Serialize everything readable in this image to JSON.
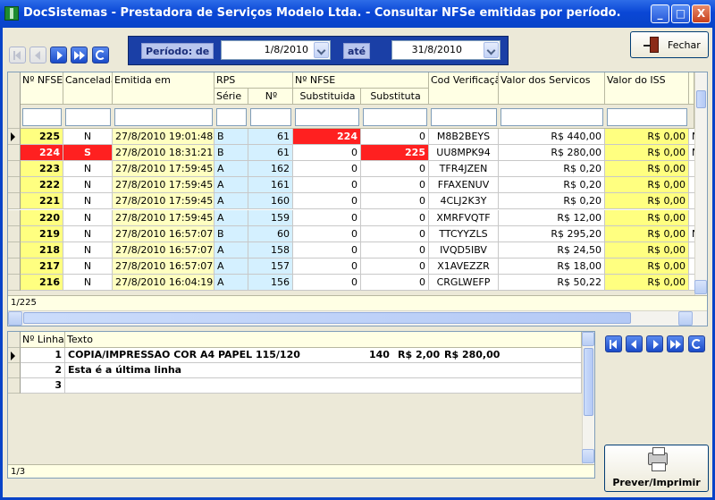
{
  "window": {
    "title": "DocSistemas - Prestadora de Serviços Modelo Ltda. - Consultar NFSe emitidas por período.",
    "controls": [
      "_",
      "□",
      "X"
    ]
  },
  "period": {
    "label_from": "Período: de",
    "from_value": "1/8/2010",
    "label_to": "até",
    "to_value": "31/8/2010"
  },
  "buttons": {
    "close": "Fechar",
    "print": "Prever/Imprimir"
  },
  "nfse_grid": {
    "headers": {
      "numero": "Nº NFSE",
      "cancelada": "Cancelada",
      "emitida": "Emitida em",
      "rps": "RPS",
      "serie": "Série",
      "rps_num": "Nº",
      "nfse_group": "Nº NFSE",
      "substituida": "Substituida",
      "substituta": "Substituta",
      "cod": "Cod Verificação",
      "valor_serv": "Valor dos Servicos",
      "valor_iss": "Valor do ISS"
    },
    "rows": [
      {
        "numero": "225",
        "cancelada": "N",
        "emitida": "27/8/2010 19:01:48",
        "serie": "B",
        "rps_num": "61",
        "substituida": "224",
        "substituta": "0",
        "cod": "M8B2BEYS",
        "valor": "R$ 440,00",
        "iss": "R$ 0,00",
        "extra": "N"
      },
      {
        "numero": "224",
        "cancelada": "S",
        "emitida": "27/8/2010 18:31:21",
        "serie": "B",
        "rps_num": "61",
        "substituida": "0",
        "substituta": "225",
        "cod": "UU8MPK94",
        "valor": "R$ 280,00",
        "iss": "R$ 0,00",
        "extra": "N"
      },
      {
        "numero": "223",
        "cancelada": "N",
        "emitida": "27/8/2010 17:59:45",
        "serie": "A",
        "rps_num": "162",
        "substituida": "0",
        "substituta": "0",
        "cod": "TFR4JZEN",
        "valor": "R$ 0,20",
        "iss": "R$ 0,00",
        "extra": ""
      },
      {
        "numero": "222",
        "cancelada": "N",
        "emitida": "27/8/2010 17:59:45",
        "serie": "A",
        "rps_num": "161",
        "substituida": "0",
        "substituta": "0",
        "cod": "FFAXENUV",
        "valor": "R$ 0,20",
        "iss": "R$ 0,00",
        "extra": ""
      },
      {
        "numero": "221",
        "cancelada": "N",
        "emitida": "27/8/2010 17:59:45",
        "serie": "A",
        "rps_num": "160",
        "substituida": "0",
        "substituta": "0",
        "cod": "4CLJ2K3Y",
        "valor": "R$ 0,20",
        "iss": "R$ 0,00",
        "extra": ""
      },
      {
        "numero": "220",
        "cancelada": "N",
        "emitida": "27/8/2010 17:59:45",
        "serie": "A",
        "rps_num": "159",
        "substituida": "0",
        "substituta": "0",
        "cod": "XMRFVQTF",
        "valor": "R$ 12,00",
        "iss": "R$ 0,00",
        "extra": ""
      },
      {
        "numero": "219",
        "cancelada": "N",
        "emitida": "27/8/2010 16:57:07",
        "serie": "B",
        "rps_num": "60",
        "substituida": "0",
        "substituta": "0",
        "cod": "TTCYYZLS",
        "valor": "R$ 295,20",
        "iss": "R$ 0,00",
        "extra": "N"
      },
      {
        "numero": "218",
        "cancelada": "N",
        "emitida": "27/8/2010 16:57:07",
        "serie": "A",
        "rps_num": "158",
        "substituida": "0",
        "substituta": "0",
        "cod": "IVQD5IBV",
        "valor": "R$ 24,50",
        "iss": "R$ 0,00",
        "extra": ""
      },
      {
        "numero": "217",
        "cancelada": "N",
        "emitida": "27/8/2010 16:57:07",
        "serie": "A",
        "rps_num": "157",
        "substituida": "0",
        "substituta": "0",
        "cod": "X1AVEZZR",
        "valor": "R$ 18,00",
        "iss": "R$ 0,00",
        "extra": ""
      },
      {
        "numero": "216",
        "cancelada": "N",
        "emitida": "27/8/2010 16:04:19",
        "serie": "A",
        "rps_num": "156",
        "substituida": "0",
        "substituta": "0",
        "cod": "CRGLWEFP",
        "valor": "R$ 50,22",
        "iss": "R$ 0,00",
        "extra": ""
      }
    ],
    "status": "1/225"
  },
  "lines_grid": {
    "headers": {
      "linha": "Nº Linha",
      "texto": "Texto"
    },
    "rows": [
      {
        "linha": "1",
        "texto": "COPIA/IMPRESSAO COR A4 PAPEL 115/120",
        "qtd": "140",
        "unit": "R$ 2,00",
        "total": "R$ 280,00"
      },
      {
        "linha": "2",
        "texto": "Esta é a última linha",
        "qtd": "",
        "unit": "",
        "total": ""
      },
      {
        "linha": "3",
        "texto": "",
        "qtd": "",
        "unit": "",
        "total": ""
      }
    ],
    "status": "1/3"
  },
  "colors": {
    "header_bg": "#ffffe4",
    "numero_bg": "#ffff80",
    "emitida_bg": "#ffffc0",
    "rps_bg": "#d4f0ff",
    "iss_bg": "#ffff80",
    "cancel_bg": "#ff2020",
    "title_bar": "#0a47d6"
  }
}
